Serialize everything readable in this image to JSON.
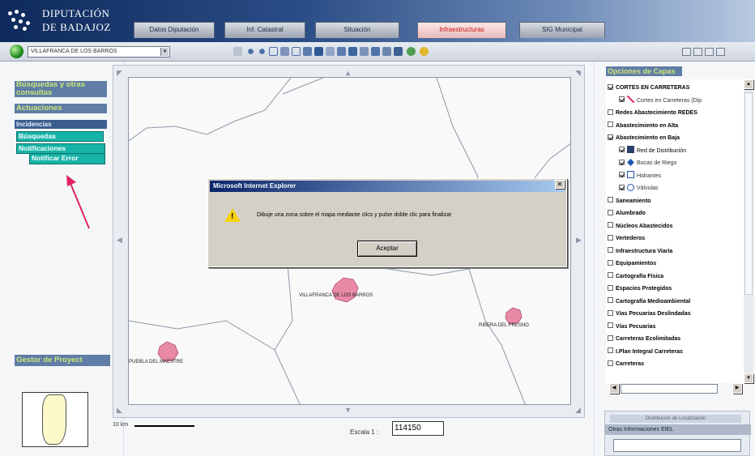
{
  "header": {
    "logo_line1": "DIPUTACIÓN",
    "logo_line2": "DE BADAJOZ",
    "tabs": [
      {
        "label": "Datos Diputación",
        "active": false
      },
      {
        "label": "Inf. Catastral",
        "active": false
      },
      {
        "label": "Situación",
        "active": false
      },
      {
        "label": "Infraestructuras",
        "active": true
      },
      {
        "label": "SIG Municipal",
        "active": false
      }
    ]
  },
  "toolbar": {
    "municipality": "VILLAFRANCA DE LOS BARROS",
    "tool_icons": [
      "hand-icon",
      "zoom-in-icon",
      "zoom-out-icon",
      "zoom-box-icon",
      "full-extent-icon",
      "identify-icon",
      "measure-icon",
      "select-icon",
      "query-icon",
      "layer-icon",
      "print-icon",
      "info-icon",
      "table-icon",
      "export-icon",
      "save-icon",
      "globe-small-icon",
      "help-icon"
    ]
  },
  "left_menu": {
    "busquedas": "Búsquedas y otras consultas",
    "actuaciones": "Actuaciones",
    "incidencias": "Incidencias",
    "sub1": "Búsquedas",
    "sub2": "Notificaciones",
    "sub3": "Notificar Error",
    "gestor": "Gestor de Proyect"
  },
  "map": {
    "towns": [
      {
        "name": "VILLAFRANCA DE LOS BARROS"
      },
      {
        "name": "RIBERA DEL FRESNO"
      },
      {
        "name": "PUEBLA DEL MAESTRE"
      }
    ]
  },
  "scale": {
    "bar_label": "10 km",
    "escala_label": "Escala 1 :",
    "escala_value": "114150"
  },
  "dialog": {
    "title": "Microsoft Internet Explorer",
    "message": "Dibuje una zona sobre el mapa mediante clics y pulse doble clic para finalizar",
    "button": "Aceptar"
  },
  "layers": {
    "title": "Opciones de Capas",
    "items": [
      {
        "label": "CORTES EN CARRETERAS",
        "checked": true,
        "indent": 0,
        "icon": "",
        "color": "#000"
      },
      {
        "label": "Cortes en Carreteras (Dip",
        "checked": true,
        "indent": 1,
        "icon": "road-icon",
        "color": "#333"
      },
      {
        "label": "Redes Abastecimiento REDES",
        "checked": false,
        "indent": 0,
        "icon": "",
        "color": "#000"
      },
      {
        "label": "Abastecimiento en Alta",
        "checked": false,
        "indent": 0,
        "icon": "",
        "color": "#000"
      },
      {
        "label": "Abastecimiento en Baja",
        "checked": true,
        "indent": 0,
        "icon": "",
        "color": "#000"
      },
      {
        "label": "Red de Distribución",
        "checked": true,
        "indent": 1,
        "icon": "network-icon",
        "color": "#000"
      },
      {
        "label": "Bocas de Riego",
        "checked": true,
        "indent": 1,
        "icon": "diamond-icon",
        "color": "#333"
      },
      {
        "label": "Hidrantes",
        "checked": true,
        "indent": 1,
        "icon": "hydrant-icon",
        "color": "#333"
      },
      {
        "label": "Válvulas",
        "checked": true,
        "indent": 1,
        "icon": "valve-icon",
        "color": "#333"
      },
      {
        "label": "Saneamiento",
        "checked": false,
        "indent": 0,
        "icon": "",
        "color": "#000"
      },
      {
        "label": "Alumbrado",
        "checked": false,
        "indent": 0,
        "icon": "",
        "color": "#000"
      },
      {
        "label": "Núcleos Abastecidos",
        "checked": false,
        "indent": 0,
        "icon": "",
        "color": "#000"
      },
      {
        "label": "Vertederos",
        "checked": false,
        "indent": 0,
        "icon": "",
        "color": "#000"
      },
      {
        "label": "Infraestructura Viaria",
        "checked": false,
        "indent": 0,
        "icon": "",
        "color": "#000"
      },
      {
        "label": "Equipamientos",
        "checked": false,
        "indent": 0,
        "icon": "",
        "color": "#000"
      },
      {
        "label": "Cartografía Física",
        "checked": false,
        "indent": 0,
        "icon": "",
        "color": "#000"
      },
      {
        "label": "Espacios Protegidos",
        "checked": false,
        "indent": 0,
        "icon": "",
        "color": "#000"
      },
      {
        "label": "Cartografía Medioambiental",
        "checked": false,
        "indent": 0,
        "icon": "",
        "color": "#000"
      },
      {
        "label": "Vías Pecuarias Deslindadas",
        "checked": false,
        "indent": 0,
        "icon": "",
        "color": "#000"
      },
      {
        "label": "Vías Pecuarias",
        "checked": false,
        "indent": 0,
        "icon": "",
        "color": "#000"
      },
      {
        "label": "Carreteras Ecolimitadas",
        "checked": false,
        "indent": 0,
        "icon": "",
        "color": "#000"
      },
      {
        "label": "I.Plan Integral Carreteras",
        "checked": false,
        "indent": 0,
        "icon": "",
        "color": "#000"
      },
      {
        "label": "Carreteras",
        "checked": false,
        "indent": 0,
        "icon": "",
        "color": "#000"
      }
    ]
  },
  "bottom_box": {
    "head": "Distribución de Localización",
    "row": "Otras Informaciones EIEL"
  },
  "colors": {
    "accent_green": "#cde67a",
    "menu_blue": "#5f7da6",
    "teal": "#16b4a8",
    "town_pink": "#e88aa6",
    "arrow": "#e0245e"
  }
}
